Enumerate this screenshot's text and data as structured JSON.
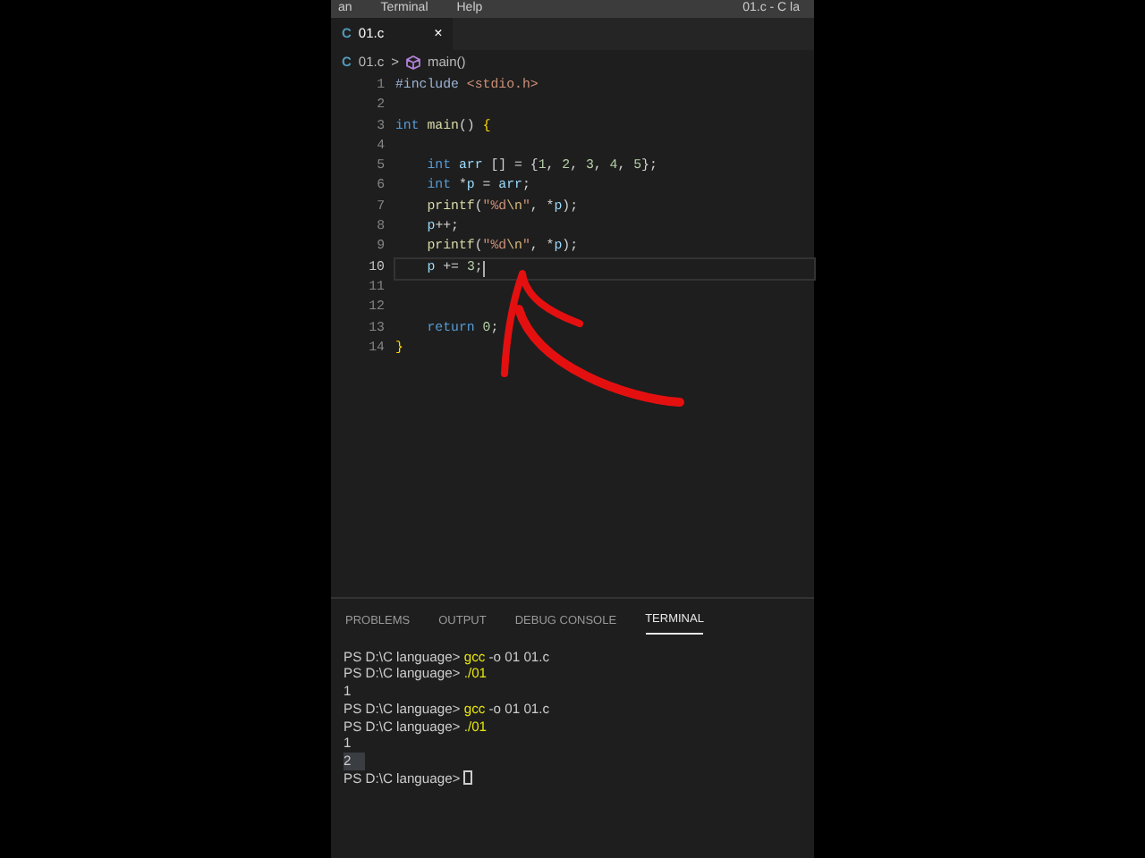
{
  "menu": [
    "an",
    "Terminal",
    "Help"
  ],
  "window_title": "01.c - C la",
  "tabs": [
    {
      "icon": "C",
      "label": "01.c",
      "close": "×",
      "selected": true
    }
  ],
  "breadcrumb": {
    "file_icon": "C",
    "file": "01.c",
    "separator": ">",
    "symbol": "main()"
  },
  "editor": {
    "lines": [
      {
        "number": "1",
        "current": false,
        "tokens": [
          {
            "kind": "pp",
            "text": "#include "
          },
          {
            "kind": "inc",
            "text": "<stdio.h>"
          }
        ]
      },
      {
        "number": "2",
        "current": false
      },
      {
        "number": "3",
        "current": false,
        "tokens": [
          {
            "kind": "kw",
            "text": "int "
          },
          {
            "kind": "fn",
            "text": "main"
          },
          {
            "kind": "punc",
            "text": "() "
          },
          {
            "kind": "brace",
            "text": "{"
          }
        ]
      },
      {
        "number": "4",
        "current": false
      },
      {
        "number": "5",
        "current": false,
        "tokens": [
          {
            "kind": "kw",
            "text": "    int "
          },
          {
            "kind": "var",
            "text": "arr"
          },
          {
            "kind": "punc",
            "text": " [] = {"
          },
          {
            "kind": "num",
            "text": "1"
          },
          {
            "kind": "punc",
            "text": ", "
          },
          {
            "kind": "num",
            "text": "2"
          },
          {
            "kind": "punc",
            "text": ", "
          },
          {
            "kind": "num",
            "text": "3"
          },
          {
            "kind": "punc",
            "text": ", "
          },
          {
            "kind": "num",
            "text": "4"
          },
          {
            "kind": "punc",
            "text": ", "
          },
          {
            "kind": "num",
            "text": "5"
          },
          {
            "kind": "punc",
            "text": "};"
          }
        ]
      },
      {
        "number": "6",
        "current": false,
        "tokens": [
          {
            "kind": "kw",
            "text": "    int"
          },
          {
            "kind": "punc",
            "text": " *"
          },
          {
            "kind": "var",
            "text": "p"
          },
          {
            "kind": "punc",
            "text": " = "
          },
          {
            "kind": "var",
            "text": "arr"
          },
          {
            "kind": "punc",
            "text": ";"
          }
        ]
      },
      {
        "number": "7",
        "current": false,
        "tokens": [
          {
            "kind": "fn",
            "text": "    printf"
          },
          {
            "kind": "punc",
            "text": "("
          },
          {
            "kind": "str",
            "text": "\"%d"
          },
          {
            "kind": "esc",
            "text": "\\n"
          },
          {
            "kind": "str",
            "text": "\""
          },
          {
            "kind": "punc",
            "text": ", *"
          },
          {
            "kind": "var",
            "text": "p"
          },
          {
            "kind": "punc",
            "text": ");"
          }
        ]
      },
      {
        "number": "8",
        "current": false,
        "tokens": [
          {
            "kind": "var",
            "text": "    p"
          },
          {
            "kind": "punc",
            "text": "++;"
          }
        ]
      },
      {
        "number": "9",
        "current": false,
        "tokens": [
          {
            "kind": "fn",
            "text": "    printf"
          },
          {
            "kind": "punc",
            "text": "("
          },
          {
            "kind": "str",
            "text": "\"%d"
          },
          {
            "kind": "esc",
            "text": "\\n"
          },
          {
            "kind": "str",
            "text": "\""
          },
          {
            "kind": "punc",
            "text": ", *"
          },
          {
            "kind": "var",
            "text": "p"
          },
          {
            "kind": "punc",
            "text": ");"
          }
        ]
      },
      {
        "number": "10",
        "current": true,
        "tokens": [
          {
            "kind": "var",
            "text": "    p"
          },
          {
            "kind": "punc",
            "text": " += "
          },
          {
            "kind": "num",
            "text": "3"
          },
          {
            "kind": "punc",
            "text": ";"
          }
        ]
      },
      {
        "number": "11",
        "current": false
      },
      {
        "number": "12",
        "current": false
      },
      {
        "number": "13",
        "current": false,
        "tokens": [
          {
            "kind": "kw",
            "text": "    return "
          },
          {
            "kind": "num",
            "text": "0"
          },
          {
            "kind": "punc",
            "text": ";"
          }
        ]
      },
      {
        "number": "14",
        "current": false,
        "tokens": [
          {
            "kind": "brace",
            "text": "}"
          }
        ]
      }
    ]
  },
  "panel": {
    "tabs": [
      {
        "label": "PROBLEMS",
        "selected": false
      },
      {
        "label": "OUTPUT",
        "selected": false
      },
      {
        "label": "DEBUG CONSOLE",
        "selected": false
      },
      {
        "label": "TERMINAL",
        "selected": true
      }
    ],
    "terminal": [
      {
        "kind": "prompt",
        "prompt": "PS D:\\C language> ",
        "program": "gcc",
        "args": " -o 01 01.c",
        "cursor": false
      },
      {
        "kind": "prompt",
        "prompt": "PS D:\\C language> ",
        "program": "./01",
        "cursor": false
      },
      {
        "kind": "output",
        "text": "1",
        "selected": false
      },
      {
        "kind": "prompt",
        "prompt": "PS D:\\C language> ",
        "program": "gcc",
        "args": " -o 01 01.c",
        "cursor": false
      },
      {
        "kind": "prompt",
        "prompt": "PS D:\\C language> ",
        "program": "./01",
        "cursor": false
      },
      {
        "kind": "output",
        "text": "1",
        "selected": false
      },
      {
        "kind": "output",
        "text": "2",
        "selected": true
      },
      {
        "kind": "prompt",
        "prompt": "PS D:\\C language> ",
        "cursor": true
      }
    ]
  }
}
